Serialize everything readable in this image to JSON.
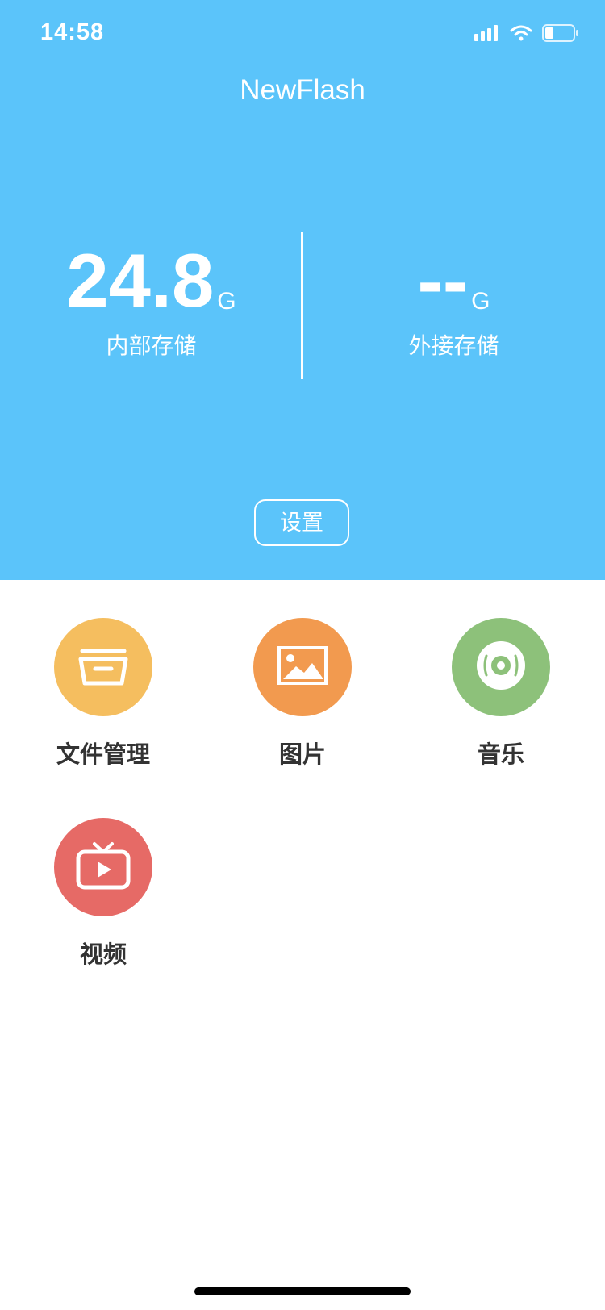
{
  "status_bar": {
    "time": "14:58"
  },
  "app": {
    "title": "NewFlash"
  },
  "storage": {
    "internal": {
      "value": "24.8",
      "unit": "G",
      "label": "内部存储"
    },
    "external": {
      "value": "--",
      "unit": "G",
      "label": "外接存储"
    }
  },
  "settings_label": "设置",
  "grid": {
    "items": [
      {
        "label": "文件管理",
        "icon": "folder-icon",
        "color": "#F5BE5F"
      },
      {
        "label": "图片",
        "icon": "image-icon",
        "color": "#F29A4F"
      },
      {
        "label": "音乐",
        "icon": "music-disc-icon",
        "color": "#8DC17A"
      },
      {
        "label": "视频",
        "icon": "tv-play-icon",
        "color": "#E66A66"
      }
    ]
  },
  "colors": {
    "header_background": "#5BC4FA"
  }
}
